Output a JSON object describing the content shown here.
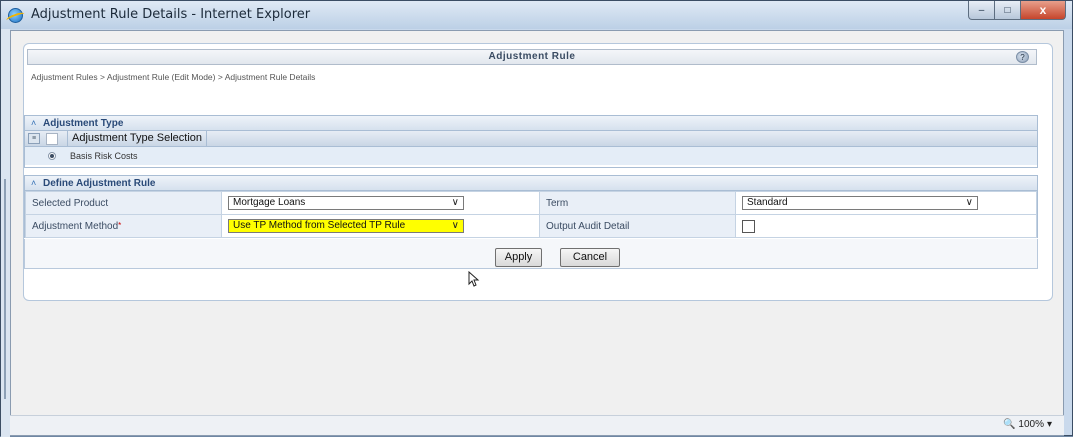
{
  "window": {
    "title": "Adjustment Rule Details - Internet Explorer",
    "min_glyph": "–",
    "max_glyph": "□",
    "close_glyph": "x"
  },
  "page": {
    "header_title": "Adjustment Rule",
    "help_glyph": "?",
    "breadcrumb": "Adjustment Rules > Adjustment Rule (Edit Mode) > Adjustment Rule Details"
  },
  "adjustment_type": {
    "section_title": "Adjustment Type",
    "collapse_glyph": "˄",
    "column_title": "Adjustment Type Selection",
    "rows": [
      {
        "label": "Basis Risk Costs",
        "selected": true
      }
    ]
  },
  "define_rule": {
    "section_title": "Define Adjustment Rule",
    "collapse_glyph": "˄",
    "selected_product_label": "Selected Product",
    "selected_product_value": "Mortgage Loans",
    "term_label": "Term",
    "term_value": "Standard",
    "adjustment_method_label": "Adjustment Method",
    "required_marker": "*",
    "adjustment_method_value": "Use TP Method from Selected TP Rule",
    "output_audit_label": "Output Audit Detail",
    "output_audit_checked": false,
    "dropdown_glyph": "∨"
  },
  "buttons": {
    "apply": "Apply",
    "cancel": "Cancel"
  },
  "status": {
    "zoom": "100%",
    "zoom_icon": "🔍",
    "zoom_arrow": "▾"
  },
  "colors": {
    "highlight": "#ffff00",
    "section_title": "#2a4a78"
  }
}
